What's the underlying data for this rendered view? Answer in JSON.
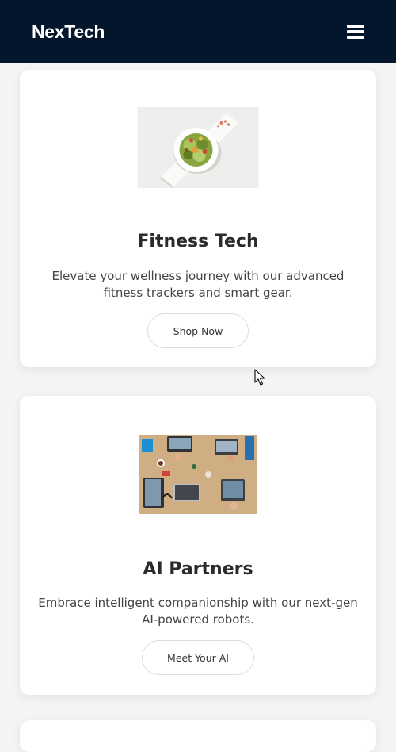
{
  "navbar": {
    "brand": "NexTech",
    "menu_icon": "hamburger-menu-icon"
  },
  "cards": [
    {
      "image_alt": "salad bowl on white board",
      "title": "Fitness Tech",
      "description": "Elevate your wellness journey with our advanced fitness trackers and smart gear.",
      "button": "Shop Now"
    },
    {
      "image_alt": "team working on laptops at a table",
      "title": "AI Partners",
      "description": "Embrace intelligent companionship with our next-gen AI-powered robots.",
      "button": "Meet Your AI"
    }
  ],
  "colors": {
    "navbar_bg": "#04162c",
    "page_bg": "#f3f4f6",
    "card_bg": "#ffffff",
    "title_text": "#2b2b2b"
  }
}
